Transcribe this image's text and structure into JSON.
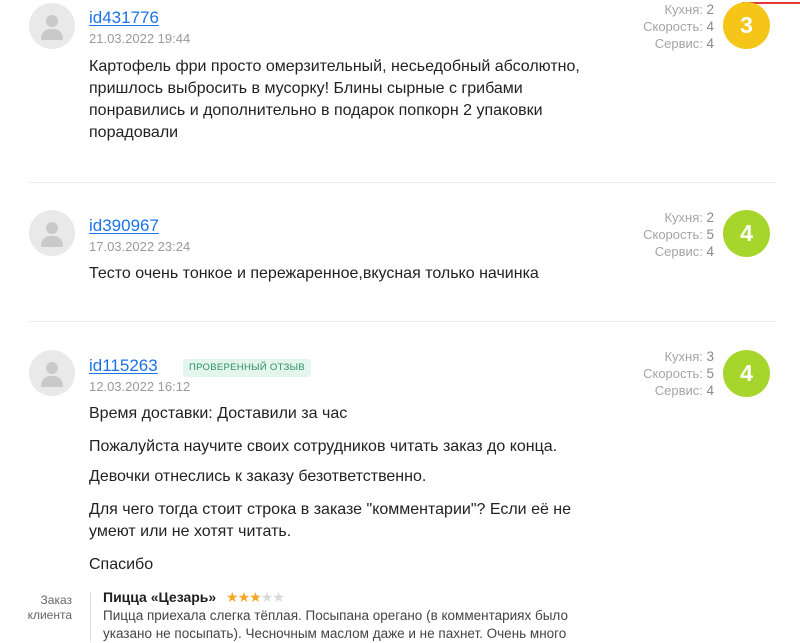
{
  "reviews": [
    {
      "user": "id431776",
      "date": "21.03.2022 19:44",
      "text": "Картофель фри просто омерзительный, несьедобный абсолютно, пришлось выбросить в мусорку! Блины сырные с грибами понравились и дополнительно в подарок попкорн 2 упаковки порадовали",
      "kitchen_label": "Кухня:",
      "kitchen_value": "2",
      "speed_label": "Скорость:",
      "speed_value": "4",
      "service_label": "Сервис:",
      "service_value": "4",
      "score": "3",
      "score_color": "#f5c518"
    },
    {
      "user": "id390967",
      "date": "17.03.2022 23:24",
      "text": "Тесто очень тонкое и пережаренное,вкусная только начинка",
      "kitchen_label": "Кухня:",
      "kitchen_value": "2",
      "speed_label": "Скорость:",
      "speed_value": "5",
      "service_label": "Сервис:",
      "service_value": "4",
      "score": "4",
      "score_color": "#a6d52b"
    },
    {
      "user": "id115263",
      "badge": "ПРОВЕРЕННЫЙ ОТЗЫВ",
      "date": "12.03.2022 16:12",
      "paragraphs": [
        "Время доставки: Доставили за час",
        "Пожалуйста научите своих сотрудников читать заказ до конца.",
        "Девочки отнеслись к заказу безответственно.",
        "Для чего тогда стоит строка в заказе \"комментарии\"? Если её не умеют или не хотят читать.",
        "Спасибо"
      ],
      "kitchen_label": "Кухня:",
      "kitchen_value": "3",
      "speed_label": "Скорость:",
      "speed_value": "5",
      "service_label": "Сервис:",
      "service_value": "4",
      "score": "4",
      "score_color": "#a6d52b"
    }
  ],
  "order": {
    "label": "Заказ клиента",
    "item_title": "Пицца «Цезарь»",
    "rating": 3,
    "rating_max": 5,
    "star_color": "#f5a623",
    "comment": "Пицца приехала слегка тёплая. Посыпана орегано (в комментариях было указано не посыпать). Чесночным маслом даже и не пахнет. Очень много"
  }
}
